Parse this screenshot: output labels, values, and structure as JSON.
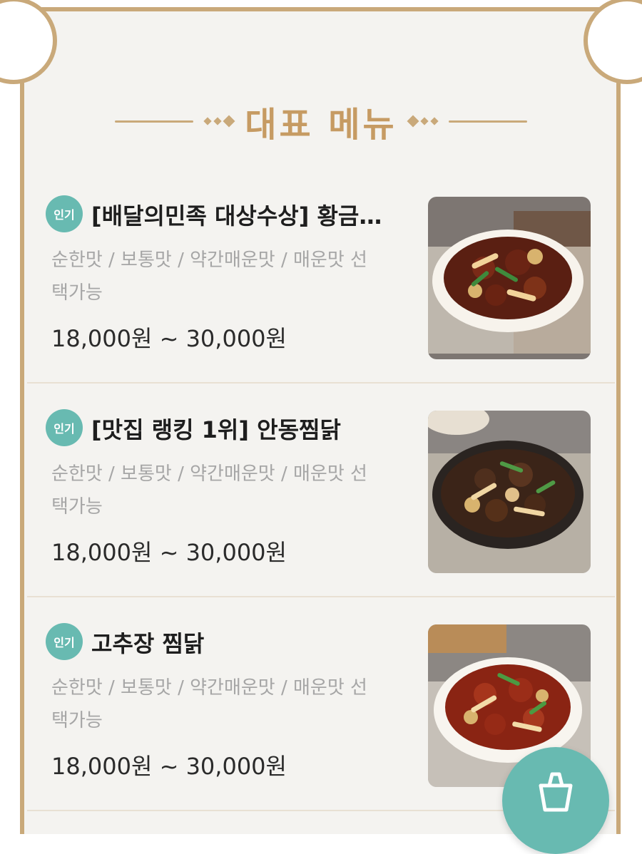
{
  "section": {
    "title": "대표 메뉴"
  },
  "menu": [
    {
      "badge": "인기",
      "name": "[배달의민족 대상수상] 황금…",
      "desc_line1": "순한맛 / 보통맛 / 약간매운맛 / 매운맛 선",
      "desc_line2": "택가능",
      "price": "18,000원 ~ 30,000원",
      "photo_icon": "braised-chicken-red-plate"
    },
    {
      "badge": "인기",
      "name": "[맛집 랭킹 1위] 안동찜닭",
      "desc_line1": "순한맛 / 보통맛 / 약간매운맛 / 매운맛 선",
      "desc_line2": "택가능",
      "price": "18,000원 ~ 30,000원",
      "photo_icon": "andong-jjimdak-dark-plate"
    },
    {
      "badge": "인기",
      "name": "고추장 찜닭",
      "desc_line1": "순한맛 / 보통맛 / 약간매운맛 / 매운맛 선",
      "desc_line2": "택가능",
      "price": "18,000원 ~ 30,000원",
      "photo_icon": "gochujang-jjimdak-white-plate"
    }
  ],
  "colors": {
    "accent_gold": "#c69b63",
    "badge_teal": "#68bab1",
    "text_dark": "#1e1e1e",
    "text_gray": "#a6a6a6"
  },
  "cart": {
    "icon": "shopping-bag-icon"
  }
}
